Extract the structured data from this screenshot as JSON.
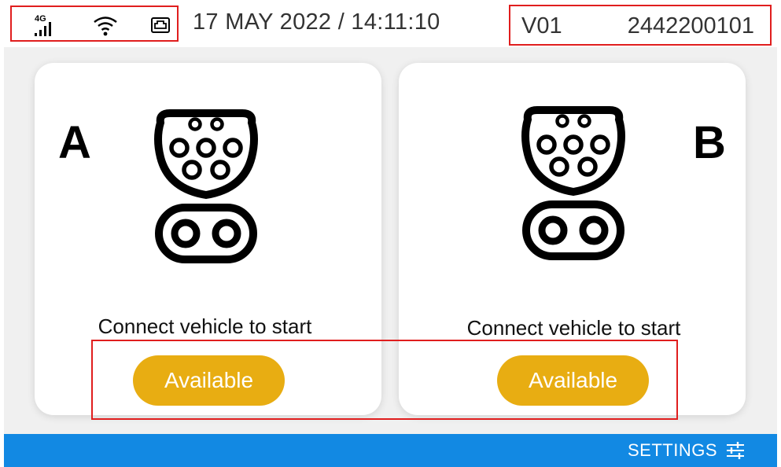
{
  "statusbar": {
    "signal_label": "4G",
    "datetime": "17 MAY 2022 / 14:11:10",
    "version": "V01",
    "serial": "2442200101",
    "icons": [
      "cellular-4g-icon",
      "wifi-icon",
      "ethernet-icon"
    ]
  },
  "connectors": [
    {
      "letter": "A",
      "message": "Connect vehicle to start",
      "status": "Available"
    },
    {
      "letter": "B",
      "message": "Connect vehicle to start",
      "status": "Available"
    }
  ],
  "bottombar": {
    "settings_label": "SETTINGS"
  },
  "colors": {
    "status_available": "#e8ad12",
    "bottom_bar": "#1289e3",
    "annotation": "#e01e1e",
    "card": "#ffffff",
    "background": "#f0f0f0"
  }
}
